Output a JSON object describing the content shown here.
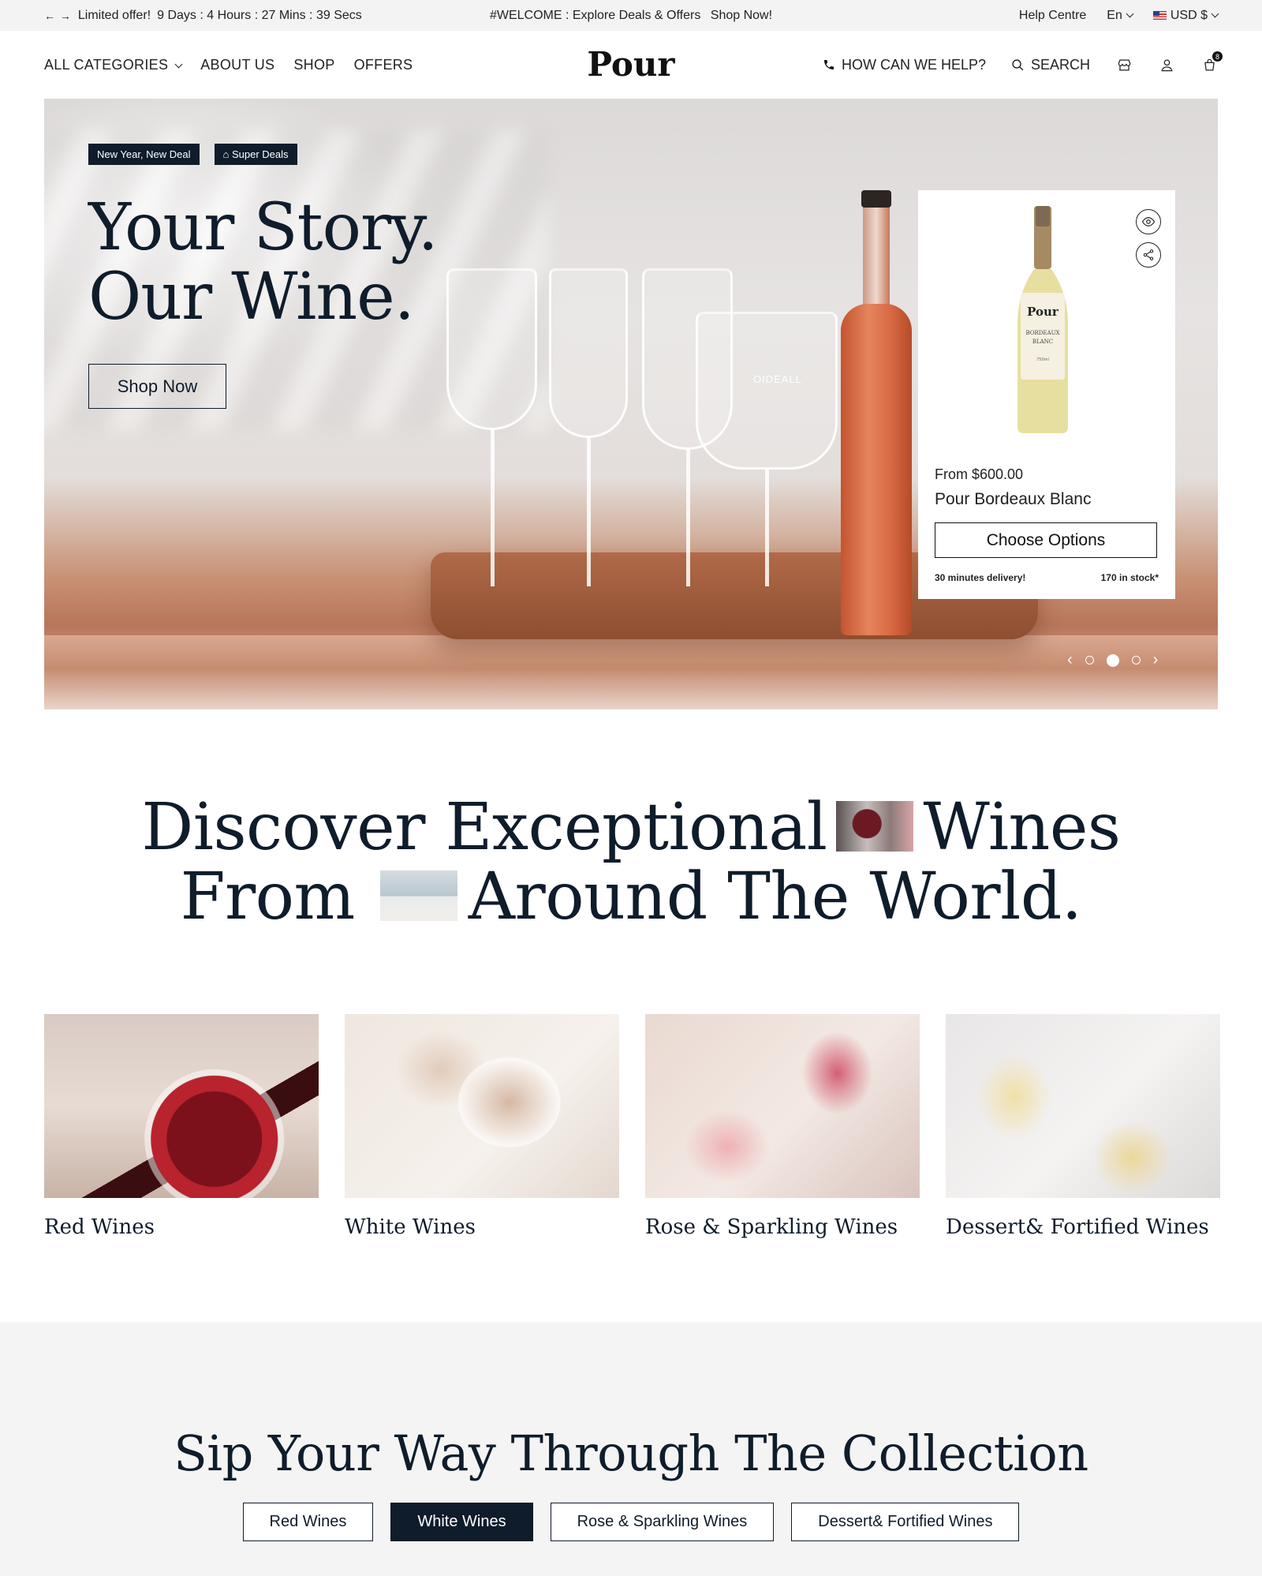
{
  "topbar": {
    "offer_label": "Limited offer!",
    "countdown": "9 Days : 4 Hours : 27 Mins : 39 Secs",
    "promo": "#WELCOME : Explore Deals & Offers",
    "promo_cta": "Shop Now!",
    "help": "Help Centre",
    "language": "En",
    "currency": "USD $"
  },
  "nav": {
    "links": [
      "ALL CATEGORIES",
      "ABOUT US",
      "SHOP",
      "OFFERS"
    ],
    "logo": "Pour",
    "help": "HOW CAN WE HELP?",
    "search": "SEARCH",
    "cart_count": "8"
  },
  "hero": {
    "badges": [
      "New Year, New Deal",
      "Super Deals"
    ],
    "title_line1": "Your Story.",
    "title_line2": "Our Wine.",
    "cta": "Shop Now",
    "glass_engraving": "OIDEALL",
    "product": {
      "bottle_brand": "Pour",
      "bottle_label_line1": "BORDEAUX",
      "bottle_label_line2": "BLANC",
      "bottle_volume": "750ml",
      "price": "From $600.00",
      "name": "Pour Bordeaux Blanc",
      "cta": "Choose Options",
      "delivery": "30 minutes delivery!",
      "stock": "170 in stock*"
    },
    "slider_active_index": 1
  },
  "discover": {
    "line1_a": "Discover Exceptional",
    "line1_b": "Wines",
    "line2_a": "From",
    "line2_b": "Around The World."
  },
  "categories": [
    {
      "label": "Red Wines"
    },
    {
      "label": "White Wines"
    },
    {
      "label": "Rose & Sparkling Wines"
    },
    {
      "label": "Dessert& Fortified Wines"
    }
  ],
  "collection": {
    "title": "Sip Your Way Through The Collection",
    "tabs": [
      "Red Wines",
      "White Wines",
      "Rose & Sparkling Wines",
      "Dessert& Fortified Wines"
    ],
    "active_tab": 1
  },
  "colors": {
    "primary": "#0f1c2b",
    "topbar_bg": "#f3f3f3",
    "section_bg": "#f4f4f4"
  }
}
